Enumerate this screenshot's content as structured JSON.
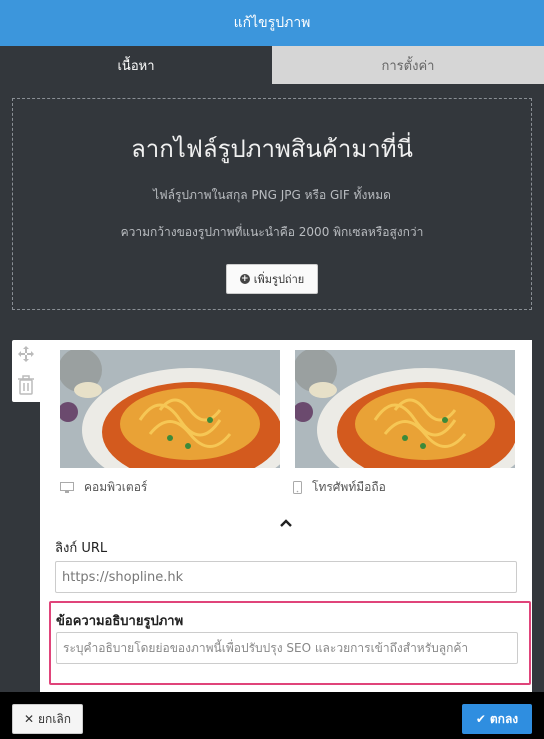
{
  "header": {
    "title": "แก้ไขรูปภาพ"
  },
  "tabs": [
    {
      "label": "เนื้อหา",
      "active": true
    },
    {
      "label": "การตั้งค่า",
      "active": false
    }
  ],
  "dropzone": {
    "title": "ลากไฟล์รูปภาพสินค้ามาที่นี่",
    "formats": "ไฟล์รูปภาพในสกุล PNG JPG หรือ GIF ทั้งหมด",
    "recommendation": "ความกว้างของรูปภาพที่แนะนำคือ 2000 พิกเซลหรือสูงกว่า",
    "add_button_label": "เพิ่มรูปถ่าย"
  },
  "previews": [
    {
      "device": "คอมพิวเตอร์",
      "icon": "desktop-icon"
    },
    {
      "device": "โทรศัพท์มือถือ",
      "icon": "mobile-icon"
    }
  ],
  "link_url": {
    "label": "ลิงก์ URL",
    "placeholder": "https://shopline.hk"
  },
  "alt_text": {
    "label": "ข้อความอธิบายรูปภาพ",
    "placeholder": "ระบุคำอธิบายโดยย่อของภาพนี้เพื่อปรับปรุง SEO และวยการเข้าถึงสำหรับลูกค้า"
  },
  "footer": {
    "cancel_label": "ยกเลิก",
    "ok_label": "ตกลง"
  },
  "colors": {
    "header": "#3c96dc",
    "highlight_border": "#e0447a",
    "ok_button": "#2f8ee0"
  }
}
